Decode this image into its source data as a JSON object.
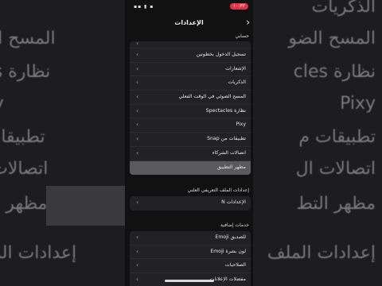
{
  "status_bar": {
    "time": "١٠:٣٢",
    "icons": "▪▪ ▮ ▪"
  },
  "header": {
    "title": "الإعدادات",
    "back_icon": "chevron-right-icon"
  },
  "sections": {
    "account_label": "حسابي",
    "account_items": [
      {
        "label": "تسجيل الدخول بخطوتين"
      },
      {
        "label": "الإشعارات"
      },
      {
        "label": "الذكريات"
      },
      {
        "label": "المسح الضوئي في الوقت الفعلي"
      },
      {
        "label": "نظارة Spectacles"
      },
      {
        "label": "Pixy"
      },
      {
        "label": "تطبيقات من Snap"
      },
      {
        "label": "اتصالات الشركاء"
      },
      {
        "label": "مظهر التطبيق",
        "selected": true
      }
    ],
    "public_profile_label": "إعدادات الملف التعريفي العلني",
    "public_profile_items": [
      {
        "label": "الإعدادات N"
      }
    ],
    "extra_services_label": "خدمات إضافية",
    "extra_services_items": [
      {
        "label": "للصديق Emoji"
      },
      {
        "label": "لون بشرة Emoji"
      },
      {
        "label": "الصلاحيات"
      },
      {
        "label": "مفضلات الإعلانات"
      }
    ]
  },
  "background_ghost": {
    "left": [
      "المسح الضو",
      "نظارة cles",
      "Pixy",
      "تطبيقات م",
      "اتصالات ال",
      "مظهر التط",
      "إعدادات الملف"
    ],
    "right": [
      "الذكريات",
      "المسح الضو",
      "نظارة cles",
      "Pixy",
      "تطبيقات م",
      "اتصالات ال",
      "مظهر التط",
      "إعدادات الملف"
    ]
  },
  "colors": {
    "accent": "#e0334a",
    "selected_row": "#5a5a5c",
    "panel": "#222224"
  }
}
